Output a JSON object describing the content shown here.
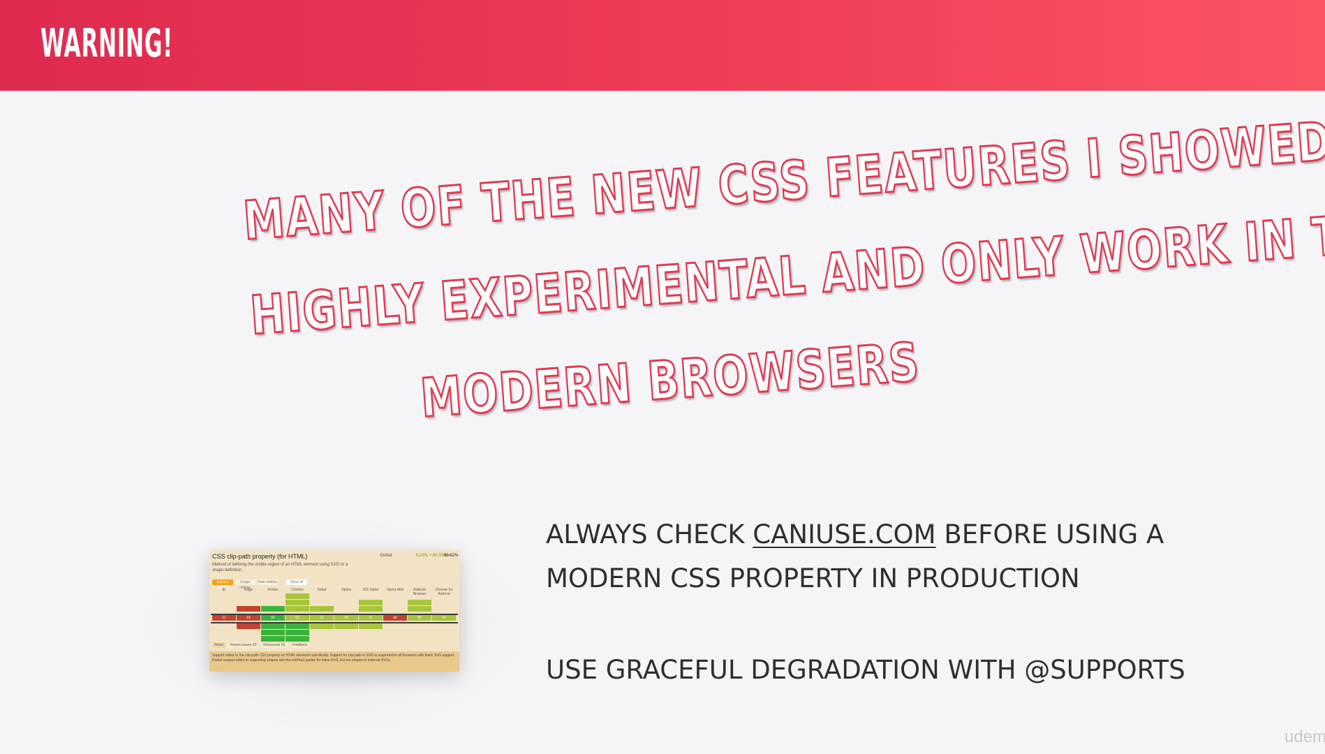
{
  "header": {
    "title": "WARNING!",
    "background_color": "#ef3a57"
  },
  "headline": {
    "lines": [
      "MANY OF THE NEW CSS FEATURES I SHOWED YOU ARE",
      "HIGHLY EXPERIMENTAL AND ONLY WORK IN TOP",
      "MODERN BROWSERS"
    ],
    "color": "#dd3c54"
  },
  "thumbnail": {
    "title": "CSS clip-path property (for HTML)",
    "description": "Method of defining the visible region of an HTML element using SVG or a shape definition.",
    "global_label": "Global",
    "usage_partial": "6.23% + 60.39% =",
    "usage_total": "66.62%",
    "tabs": [
      "Current aligned",
      "Usage relative",
      "Date relative",
      "Show all"
    ],
    "browsers": [
      "IE",
      "Edge",
      "Firefox",
      "Chrome",
      "Safari",
      "Opera",
      "iOS Safari",
      "Opera Mini",
      "Android Browser",
      "Chrome for Android"
    ],
    "current_row": [
      "11",
      "15",
      "56",
      "61",
      "11",
      "47",
      "11",
      "all",
      "56",
      "62"
    ],
    "subtabs": [
      "Notes",
      "Known issues (0)",
      "Resources (5)",
      "Feedback"
    ],
    "notes": [
      "Support refers to the clip-path CSS property on HTML elements specifically. Support for clip-path in SVG is supported in all browsers with basic SVG support.",
      "Partial support refers to supporting shapes and the url(#foo) syntax for inline SVG, but not shapes in external SVGs."
    ]
  },
  "body": {
    "line1_prefix": "ALWAYS CHECK ",
    "line1_link": "CANIUSE.COM",
    "line1_suffix": " BEFORE USING A",
    "line2": "MODERN CSS PROPERTY IN PRODUCTION",
    "line3": "USE GRACEFUL DEGRADATION WITH @SUPPORTS"
  },
  "watermark": "udem"
}
